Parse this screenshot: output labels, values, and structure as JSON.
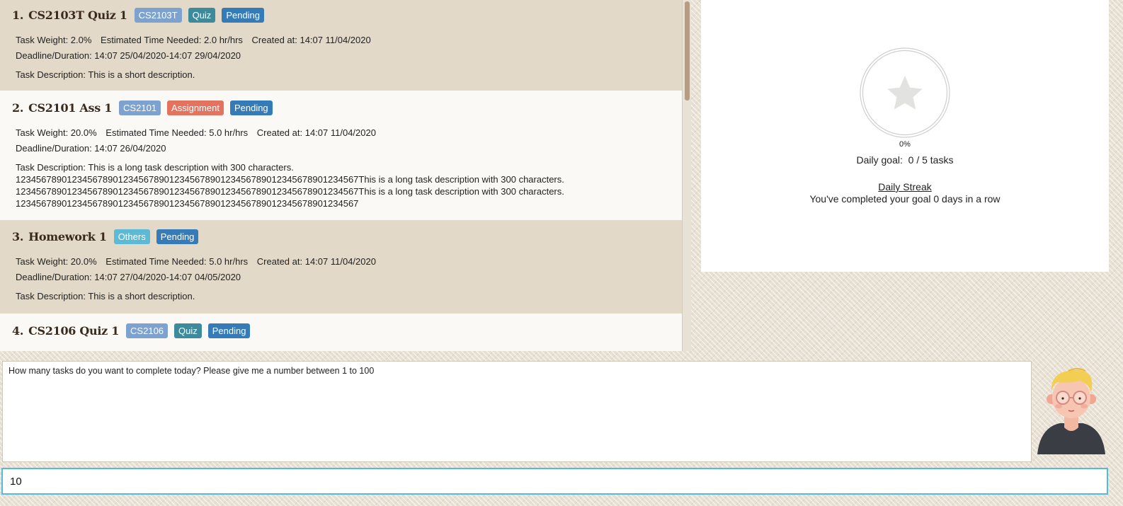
{
  "tasks": [
    {
      "index": "1.",
      "name": "CS2103T Quiz 1",
      "tags": {
        "module": "CS2103T",
        "type": "Quiz",
        "status": "Pending"
      },
      "weight": "Task Weight: 2.0%",
      "time_needed": "Estimated Time Needed: 2.0 hr/hrs",
      "created": "Created at: 14:07 11/04/2020",
      "deadline": "Deadline/Duration: 14:07 25/04/2020-14:07 29/04/2020",
      "description": "Task Description: This is a short description."
    },
    {
      "index": "2.",
      "name": "CS2101 Ass 1",
      "tags": {
        "module": "CS2101",
        "type": "Assignment",
        "status": "Pending"
      },
      "weight": "Task Weight: 20.0%",
      "time_needed": "Estimated Time Needed: 5.0 hr/hrs",
      "created": "Created at: 14:07 11/04/2020",
      "deadline": "Deadline/Duration: 14:07 26/04/2020",
      "description": "Task Description: This is a long task description with 300 characters.\n1234567890123456789012345678901234567890123456789012345678901234567This is a long task description with 300 characters.\n1234567890123456789012345678901234567890123456789012345678901234567This is a long task description with 300 characters.\n1234567890123456789012345678901234567890123456789012345678901234567"
    },
    {
      "index": "3.",
      "name": "Homework 1",
      "tags": {
        "type": "Others",
        "status": "Pending"
      },
      "weight": "Task Weight: 20.0%",
      "time_needed": "Estimated Time Needed: 5.0 hr/hrs",
      "created": "Created at: 14:07 11/04/2020",
      "deadline": "Deadline/Duration: 14:07 27/04/2020-14:07 04/05/2020",
      "description": "Task Description: This is a short description."
    },
    {
      "index": "4.",
      "name": "CS2106 Quiz 1",
      "tags": {
        "module": "CS2106",
        "type": "Quiz",
        "status": "Pending"
      }
    }
  ],
  "goal": {
    "progress_fraction": 0.0,
    "progress_label": "0%",
    "daily_goal": "Daily goal:  0 / 5 tasks",
    "streak_title": "Daily Streak",
    "streak_text": "You've completed your goal 0 days in a row"
  },
  "result_display": "How many tasks do you want to complete today? Please give me a number between 1 to 100",
  "command_input": {
    "value": "10"
  },
  "icons": {
    "progress": "star-icon",
    "avatar": "character-avatar-icon"
  },
  "colors": {
    "tag_module": "#7ea2d0",
    "tag_quiz": "#3d8a9c",
    "tag_assignment": "#e3735f",
    "tag_others": "#5bbad5",
    "tag_status": "#347bb8",
    "card_odd": "#e3d9c9",
    "card_even": "#fbf9f5",
    "input_border": "#56b9d6"
  }
}
